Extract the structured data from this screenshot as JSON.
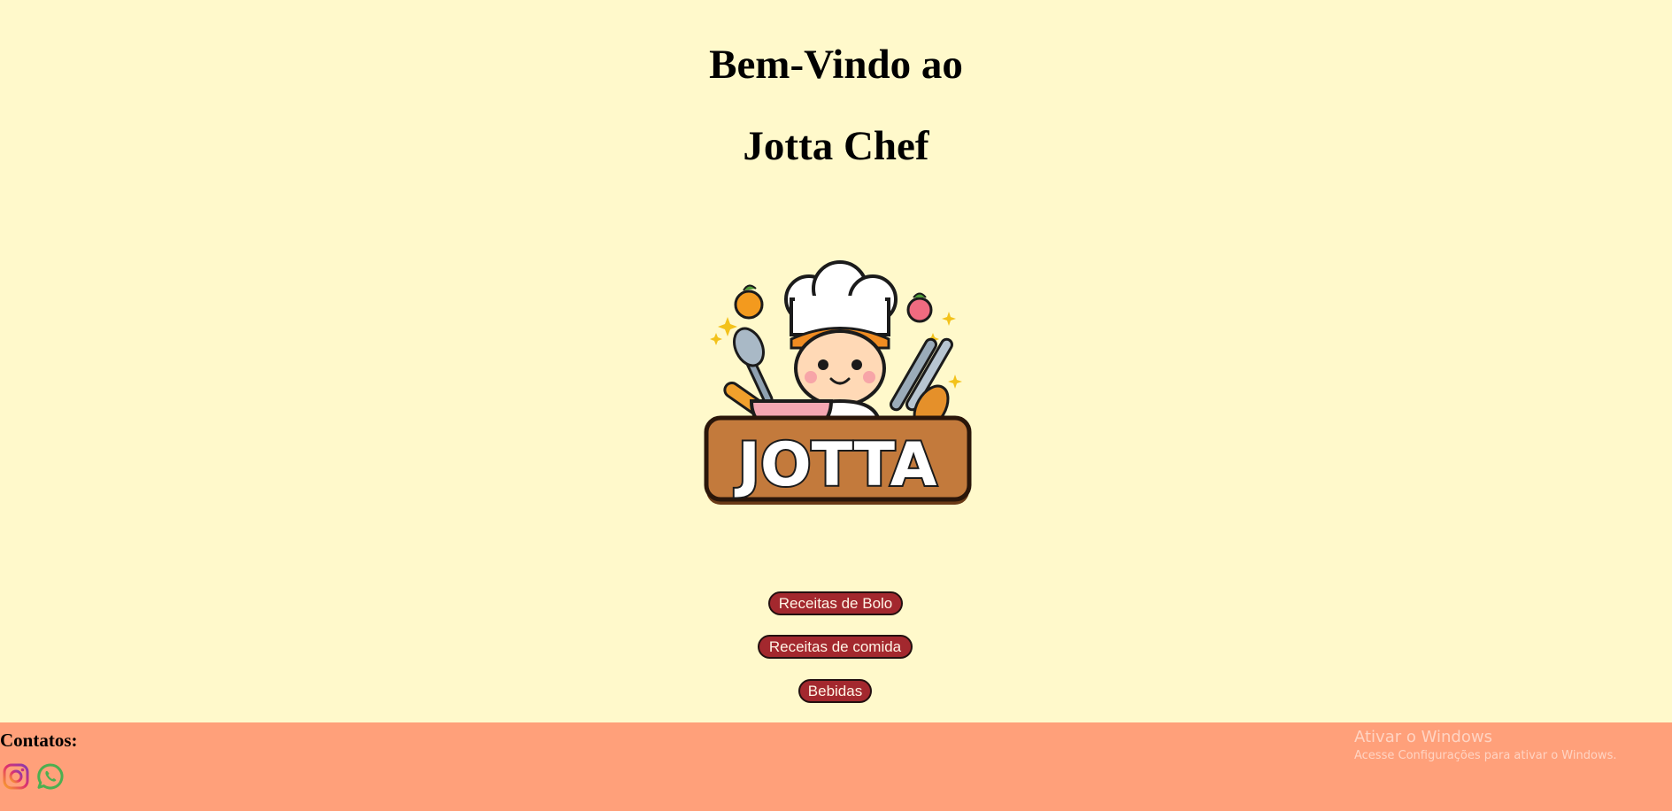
{
  "header": {
    "title_line_1": "Bem-Vindo ao",
    "title_line_2": "Jotta Chef"
  },
  "logo": {
    "text": "JOTTA",
    "icon": "chef-mascot-logo"
  },
  "nav": {
    "buttons": [
      {
        "label": "Receitas de Bolo"
      },
      {
        "label": "Receitas de comida"
      },
      {
        "label": "Bebidas"
      }
    ]
  },
  "footer": {
    "contacts_label": "Contatos:",
    "social": [
      {
        "icon": "instagram-icon"
      },
      {
        "icon": "whatsapp-icon"
      }
    ]
  },
  "watermark": {
    "title": "Ativar o Windows",
    "subtitle": "Acesse Configurações para ativar o Windows."
  },
  "colors": {
    "background": "#fff9cb",
    "footer": "#ffa07a",
    "button": "#a3282e",
    "button_text": "#fff4e6"
  }
}
